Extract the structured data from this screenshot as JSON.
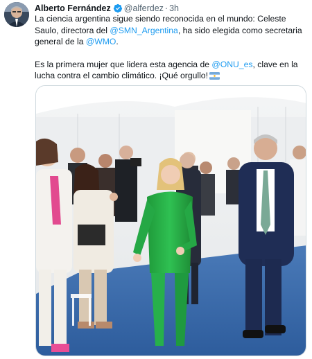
{
  "tweet": {
    "author_name": "Alberto Fernández",
    "handle": "@alferdez",
    "separator": "·",
    "time": "3h",
    "line1_pre": "La ciencia argentina sigue siendo reconocida en el mundo: Celeste Saulo, directora del ",
    "mention_smn": "@SMN_Argentina",
    "line1_mid": ", ha sido elegida como secretaria general de la ",
    "mention_wmo": "@WMO",
    "line1_end": ".",
    "line2_pre": "Es la primera mujer que lidera esta agencia de ",
    "mention_onu": "@ONU_es",
    "line2_end": ", clave en la lucha contra el cambio climático. ¡Qué orgullo!"
  },
  "icons": {
    "verified": "verified-badge-icon",
    "flag": "argentina-flag-icon"
  },
  "colors": {
    "link": "#1d9bf0",
    "secondary_text": "#536471",
    "primary_text": "#0f1419",
    "verified": "#1d9bf0"
  }
}
